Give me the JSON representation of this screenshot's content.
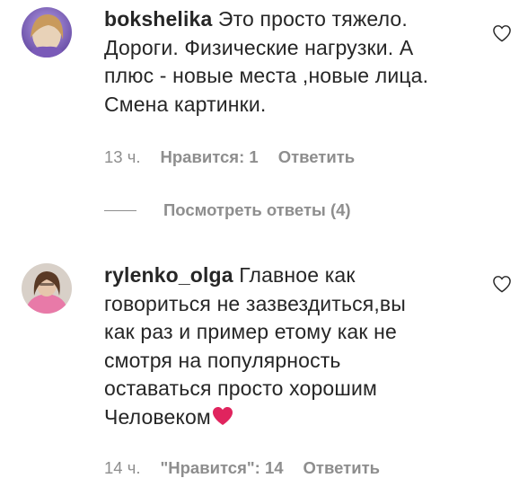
{
  "comments": [
    {
      "username": "bokshelika",
      "text_line1": " Это просто тяжело.",
      "text_line2": "Дороги. Физические нагрузки. А",
      "text_line3": "плюс - новые места ,новые лица.",
      "text_line4": "Смена картинки.",
      "time": "13 ч.",
      "likes": "Нравится: 1",
      "reply": "Ответить",
      "view_replies": "Посмотреть ответы (4)"
    },
    {
      "username": "rylenko_olga",
      "text_line1": " Главное как",
      "text_line2": "говориться не зазвездиться,вы",
      "text_line3": "как раз и пример етому как не",
      "text_line4": "смотря на популярность",
      "text_line5": "оставаться просто хорошим",
      "text_line6": "Человеком",
      "time": "14 ч.",
      "likes": "\"Нравится\": 14",
      "reply": "Ответить"
    }
  ],
  "icons": {
    "like": "heart-outline-icon",
    "emoji": "red-heart-emoji"
  },
  "colors": {
    "text": "#262626",
    "secondary": "#8e8e8e",
    "heart_emoji": "#e0245e"
  }
}
